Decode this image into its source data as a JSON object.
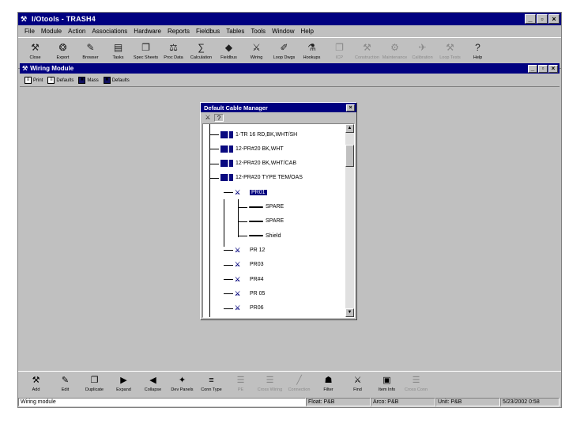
{
  "window": {
    "title": "I/Otools - TRASH4",
    "icon": "app-icon"
  },
  "menu": [
    "File",
    "Module",
    "Action",
    "Associations",
    "Hardware",
    "Reports",
    "Fieldbus",
    "Tables",
    "Tools",
    "Window",
    "Help"
  ],
  "toolbar": [
    {
      "label": "Close",
      "icon": "⚒",
      "disabled": false
    },
    {
      "label": "Export",
      "icon": "❂",
      "disabled": false
    },
    {
      "label": "Browser",
      "icon": "✎",
      "disabled": false
    },
    {
      "label": "Tasks",
      "icon": "▤",
      "disabled": false
    },
    {
      "label": "Spec Sheets",
      "icon": "❐",
      "disabled": false
    },
    {
      "label": "Proc Data",
      "icon": "⚖",
      "disabled": false
    },
    {
      "label": "Calculation",
      "icon": "∑",
      "disabled": false
    },
    {
      "label": "Fieldbus",
      "icon": "◆",
      "disabled": false
    },
    {
      "label": "Wiring",
      "icon": "⚔",
      "disabled": false
    },
    {
      "label": "Loop Dwgs",
      "icon": "✐",
      "disabled": false
    },
    {
      "label": "Hookups",
      "icon": "⚗",
      "disabled": false
    },
    {
      "label": "ICP",
      "icon": "❐",
      "disabled": true
    },
    {
      "label": "Construction",
      "icon": "⚒",
      "disabled": true
    },
    {
      "label": "Maintenance",
      "icon": "⚙",
      "disabled": true
    },
    {
      "label": "Calibration",
      "icon": "✈",
      "disabled": true
    },
    {
      "label": "Loop Tests",
      "icon": "⚒",
      "disabled": true
    },
    {
      "label": "Help",
      "icon": "?",
      "disabled": false
    }
  ],
  "child": {
    "title": "Wiring Module",
    "tools": [
      {
        "label": "Print",
        "icon": "≡"
      },
      {
        "label": "Defaults",
        "icon": "≡"
      },
      {
        "label": "Mass",
        "icon": "■"
      },
      {
        "label": "Defaults",
        "icon": "■"
      }
    ]
  },
  "dialog": {
    "title": "Default Cable Manager",
    "tools": [
      {
        "icon": "⚔",
        "name": "binoculars-icon"
      },
      {
        "icon": "?",
        "name": "help-icon"
      }
    ],
    "nodes": [
      {
        "text": "1-TR 16 RD,BK,WHT/SH",
        "level": 0,
        "kind": "cable"
      },
      {
        "text": "12-PR#20 BK,WHT",
        "level": 0,
        "kind": "cable"
      },
      {
        "text": "12-PR#20 BK,WHT/CAB",
        "level": 0,
        "kind": "cable"
      },
      {
        "text": "12-PR#20 TYPE TEM/OAS",
        "level": 0,
        "kind": "cable"
      },
      {
        "text": "PR01",
        "level": 1,
        "kind": "pair",
        "selected": true
      },
      {
        "text": "SPARE",
        "level": 2,
        "kind": "wire"
      },
      {
        "text": "SPARE",
        "level": 2,
        "kind": "wire"
      },
      {
        "text": "Shield",
        "level": 2,
        "kind": "wire"
      },
      {
        "text": "PR 12",
        "level": 1,
        "kind": "pair"
      },
      {
        "text": "PR03",
        "level": 1,
        "kind": "pair"
      },
      {
        "text": "PR#4",
        "level": 1,
        "kind": "pair"
      },
      {
        "text": "PR 05",
        "level": 1,
        "kind": "pair"
      },
      {
        "text": "PR06",
        "level": 1,
        "kind": "pair"
      }
    ]
  },
  "bottombar": [
    {
      "label": "Add",
      "icon": "⚒",
      "disabled": false
    },
    {
      "label": "Edit",
      "icon": "✎",
      "disabled": false
    },
    {
      "label": "Duplicate",
      "icon": "❐",
      "disabled": false
    },
    {
      "label": "Expand",
      "icon": "▶",
      "disabled": false
    },
    {
      "label": "Collapse",
      "icon": "◀",
      "disabled": false
    },
    {
      "label": "Dev Panels",
      "icon": "✦",
      "disabled": false
    },
    {
      "label": "Conn Type",
      "icon": "≡",
      "disabled": false
    },
    {
      "label": "PE",
      "icon": "☰",
      "disabled": true
    },
    {
      "label": "Cross Wiring",
      "icon": "☰",
      "disabled": true
    },
    {
      "label": "Connection",
      "icon": "╱",
      "disabled": true
    },
    {
      "label": "Filter",
      "icon": "☗",
      "disabled": false
    },
    {
      "label": "Find",
      "icon": "⚔",
      "disabled": false
    },
    {
      "label": "Item Info",
      "icon": "▣",
      "disabled": false
    },
    {
      "label": "Cross Conn",
      "icon": "☰",
      "disabled": true
    }
  ],
  "status": {
    "main": "Wiring module",
    "pane1": "Float: P&B",
    "pane2": "Arco: P&B",
    "pane3": "Unit: P&B",
    "date": "5/23/2002 0:58"
  }
}
